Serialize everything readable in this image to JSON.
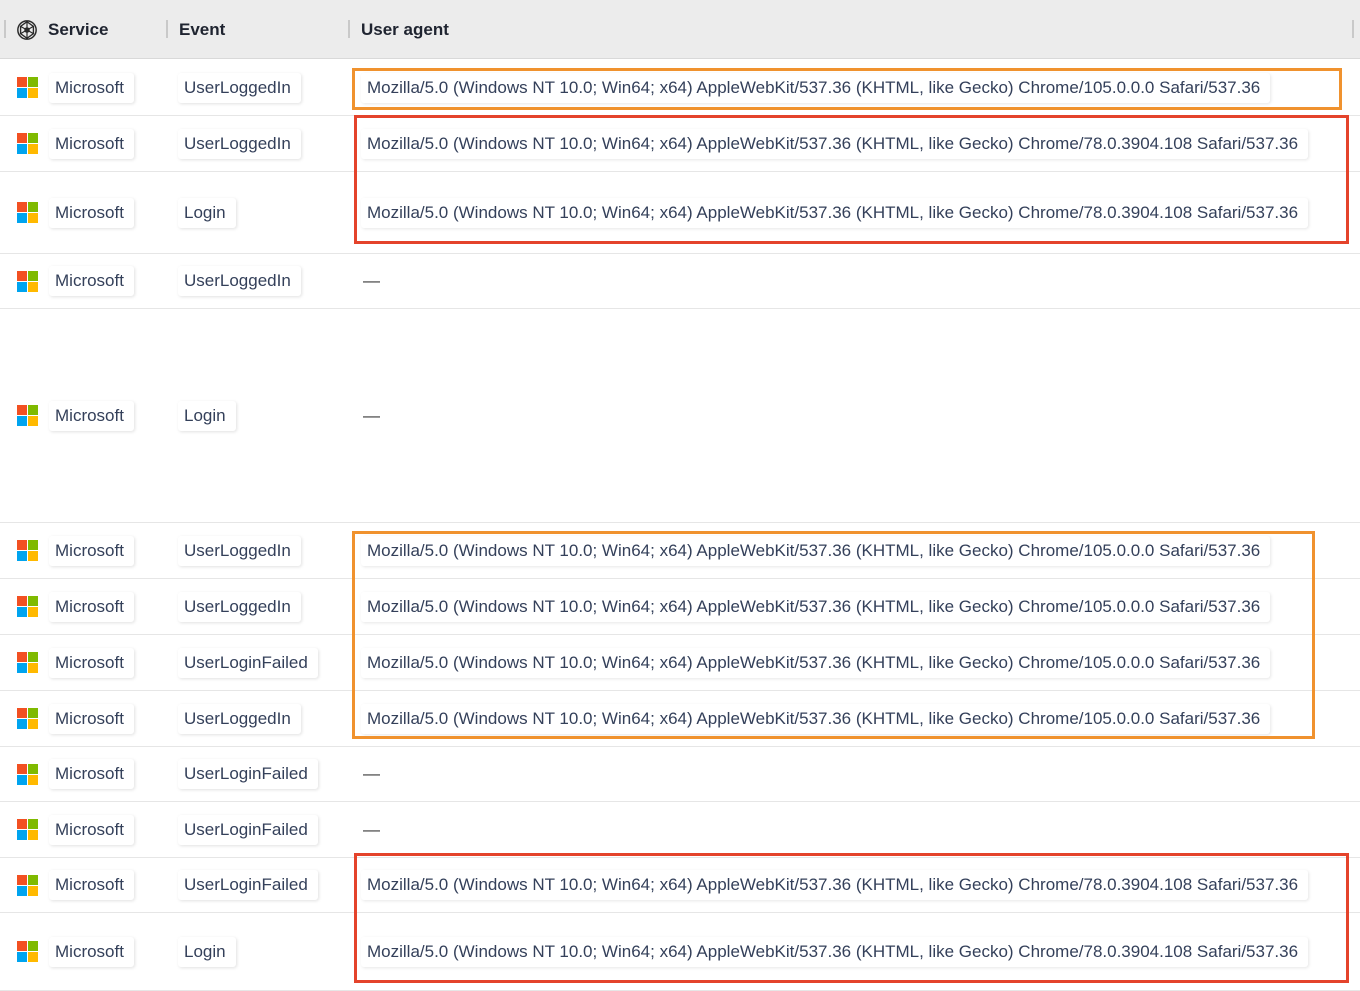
{
  "columns": {
    "service": "Service",
    "event": "Event",
    "user_agent": "User agent"
  },
  "colors": {
    "orange_highlight": "#f0922e",
    "red_highlight": "#e4432b",
    "ms_red": "#f25022",
    "ms_green": "#7fba00",
    "ms_blue": "#00a4ef",
    "ms_yellow": "#ffb900"
  },
  "icons": {
    "service_header": "service-app-icon",
    "row_service": "microsoft-logo-icon"
  },
  "rows": [
    {
      "service": "Microsoft",
      "event": "UserLoggedIn",
      "user_agent": "Mozilla/5.0 (Windows NT 10.0; Win64; x64) AppleWebKit/537.36 (KHTML, like Gecko) Chrome/105.0.0.0 Safari/537.36"
    },
    {
      "service": "Microsoft",
      "event": "UserLoggedIn",
      "user_agent": "Mozilla/5.0 (Windows NT 10.0; Win64; x64) AppleWebKit/537.36 (KHTML, like Gecko) Chrome/78.0.3904.108 Safari/537.36"
    },
    {
      "service": "Microsoft",
      "event": "Login",
      "user_agent": "Mozilla/5.0 (Windows NT 10.0; Win64; x64) AppleWebKit/537.36 (KHTML, like Gecko) Chrome/78.0.3904.108 Safari/537.36"
    },
    {
      "service": "Microsoft",
      "event": "UserLoggedIn",
      "user_agent": "—"
    },
    {
      "service": "Microsoft",
      "event": "Login",
      "user_agent": "—"
    },
    {
      "service": "Microsoft",
      "event": "UserLoggedIn",
      "user_agent": "Mozilla/5.0 (Windows NT 10.0; Win64; x64) AppleWebKit/537.36 (KHTML, like Gecko) Chrome/105.0.0.0 Safari/537.36"
    },
    {
      "service": "Microsoft",
      "event": "UserLoggedIn",
      "user_agent": "Mozilla/5.0 (Windows NT 10.0; Win64; x64) AppleWebKit/537.36 (KHTML, like Gecko) Chrome/105.0.0.0 Safari/537.36"
    },
    {
      "service": "Microsoft",
      "event": "UserLoginFailed",
      "user_agent": "Mozilla/5.0 (Windows NT 10.0; Win64; x64) AppleWebKit/537.36 (KHTML, like Gecko) Chrome/105.0.0.0 Safari/537.36"
    },
    {
      "service": "Microsoft",
      "event": "UserLoggedIn",
      "user_agent": "Mozilla/5.0 (Windows NT 10.0; Win64; x64) AppleWebKit/537.36 (KHTML, like Gecko) Chrome/105.0.0.0 Safari/537.36"
    },
    {
      "service": "Microsoft",
      "event": "UserLoginFailed",
      "user_agent": "—"
    },
    {
      "service": "Microsoft",
      "event": "UserLoginFailed",
      "user_agent": "—"
    },
    {
      "service": "Microsoft",
      "event": "UserLoginFailed",
      "user_agent": "Mozilla/5.0 (Windows NT 10.0; Win64; x64) AppleWebKit/537.36 (KHTML, like Gecko) Chrome/78.0.3904.108 Safari/537.36"
    },
    {
      "service": "Microsoft",
      "event": "Login",
      "user_agent": "Mozilla/5.0 (Windows NT 10.0; Win64; x64) AppleWebKit/537.36 (KHTML, like Gecko) Chrome/78.0.3904.108 Safari/537.36"
    }
  ],
  "highlight_groups": [
    {
      "color": "orange",
      "rows": [
        0
      ]
    },
    {
      "color": "red",
      "rows": [
        1,
        2
      ]
    },
    {
      "color": "orange",
      "rows": [
        5,
        6,
        7,
        8
      ]
    },
    {
      "color": "red",
      "rows": [
        11,
        12
      ]
    }
  ]
}
